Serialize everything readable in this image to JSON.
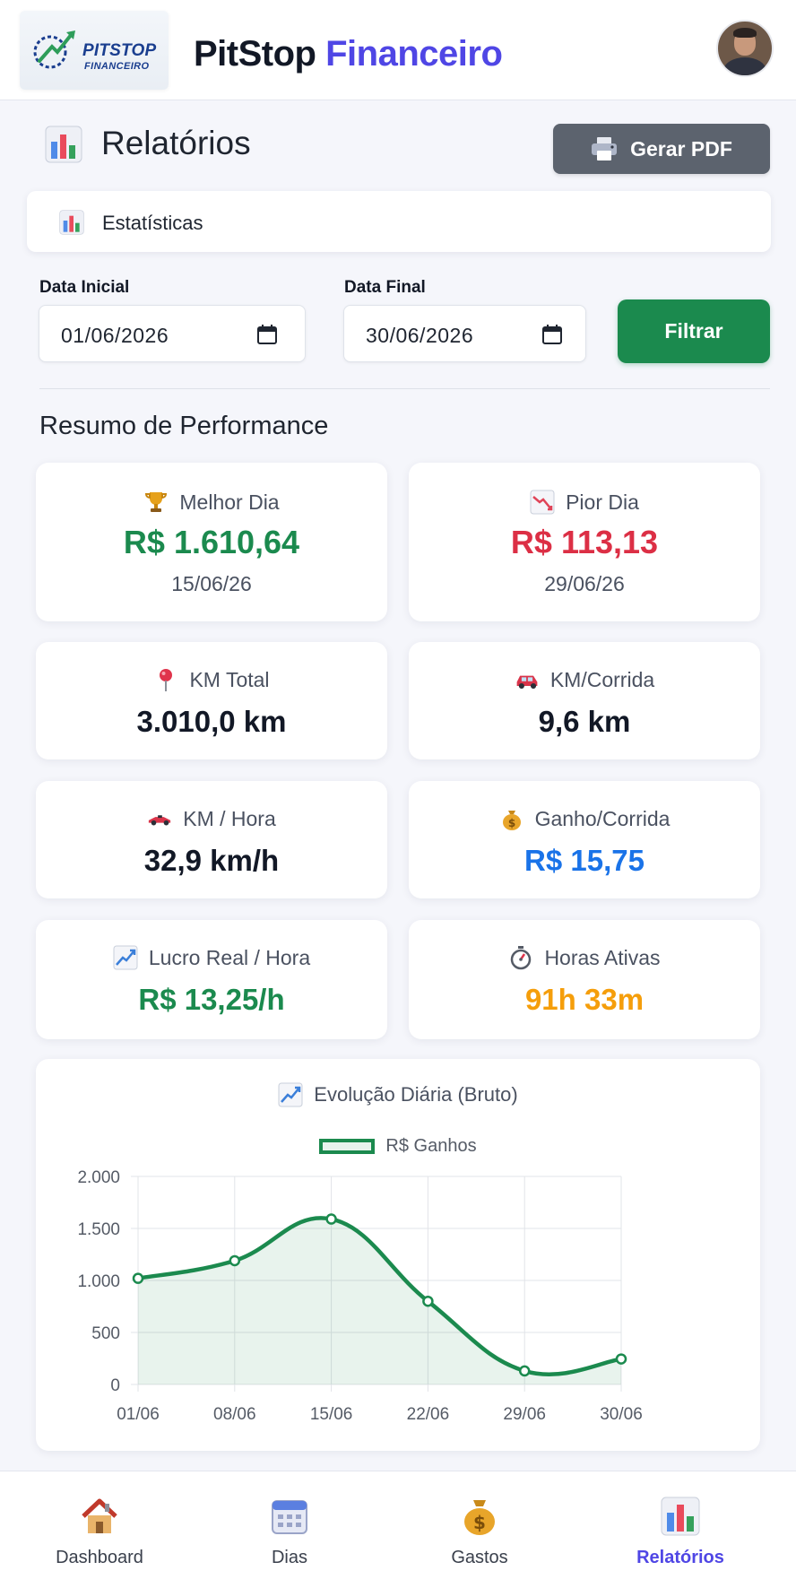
{
  "header": {
    "logo_line1": "PITSTOP",
    "logo_line2": "FINANCEIRO",
    "brand_part1": "PitStop",
    "brand_part2": "Financeiro"
  },
  "page": {
    "title": "Relatórios",
    "pdf_button": "Gerar PDF",
    "tab_label": "Estatísticas"
  },
  "filter": {
    "start_label": "Data Inicial",
    "start_value": "01/06/2026",
    "end_label": "Data Final",
    "end_value": "30/06/2026",
    "button": "Filtrar"
  },
  "summary": {
    "title": "Resumo de Performance",
    "best_day": {
      "label": "Melhor Dia",
      "value": "R$ 1.610,64",
      "date": "15/06/26",
      "icon": "trophy-icon"
    },
    "worst_day": {
      "label": "Pior Dia",
      "value": "R$ 113,13",
      "date": "29/06/26",
      "icon": "chart-decreasing-icon"
    },
    "km_total": {
      "label": "KM Total",
      "value": "3.010,0 km",
      "icon": "pin-icon"
    },
    "km_per_ride": {
      "label": "KM/Corrida",
      "value": "9,6 km",
      "icon": "car-icon"
    },
    "km_per_hour": {
      "label": "KM / Hora",
      "value": "32,9 km/h",
      "icon": "race-car-icon"
    },
    "earn_per_ride": {
      "label": "Ganho/Corrida",
      "value": "R$ 15,75",
      "icon": "money-bag-icon"
    },
    "profit_per_hour": {
      "label": "Lucro Real / Hora",
      "value": "R$ 13,25/h",
      "icon": "chart-increasing-icon"
    },
    "active_hours": {
      "label": "Horas Ativas",
      "value": "91h 33m",
      "icon": "stopwatch-icon"
    }
  },
  "colors": {
    "green": "#1b8a4e",
    "red": "#dc2f45",
    "blue": "#1a73e8",
    "orange": "#f59e0b",
    "indigo": "#4f46e5"
  },
  "chart_data": {
    "type": "line",
    "title": "Evolução Diária (Bruto)",
    "categories": [
      "01/06",
      "08/06",
      "15/06",
      "22/06",
      "29/06",
      "30/06"
    ],
    "series": [
      {
        "name": "R$ Ganhos",
        "values": [
          1020,
          1190,
          1590,
          800,
          130,
          245
        ]
      }
    ],
    "y_ticks": [
      "0",
      "500",
      "1.000",
      "1.500",
      "2.000"
    ],
    "ylim": [
      0,
      2000
    ],
    "area_fill": true,
    "grid": true,
    "legend_position": "top-center"
  },
  "nav": {
    "items": [
      {
        "label": "Dashboard",
        "icon": "house-icon"
      },
      {
        "label": "Dias",
        "icon": "calendar-icon"
      },
      {
        "label": "Gastos",
        "icon": "money-bag-icon"
      },
      {
        "label": "Relatórios",
        "icon": "bar-chart-icon"
      }
    ],
    "active": "Relatórios"
  }
}
